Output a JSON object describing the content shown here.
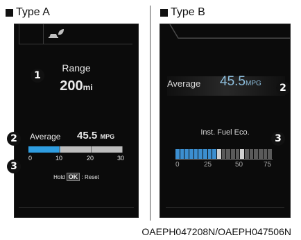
{
  "type_a": {
    "label": "Type A",
    "range": {
      "title": "Range",
      "value": "200",
      "unit": "mi"
    },
    "average": {
      "label": "Average",
      "value": "45.5",
      "unit": "MPG"
    },
    "gauge": {
      "ticks": [
        "0",
        "10",
        "20",
        "30"
      ],
      "fill_fraction": 0.34
    },
    "hint": {
      "prefix": "Hold",
      "key": "OK",
      "suffix": ": Reset"
    },
    "top_icon": "eco-car-leaf-icon"
  },
  "type_b": {
    "label": "Type B",
    "average": {
      "label": "Average",
      "value": "45.5",
      "unit": "MPG"
    },
    "inst": {
      "title": "Inst. Fuel Eco.",
      "ticks": [
        "0",
        "25",
        "50",
        "75"
      ],
      "segments_total": 21,
      "segments_filled": 9
    }
  },
  "badges": {
    "one": "1",
    "two": "2",
    "three": "3"
  },
  "caption": "OAEPH047208N/OAEPH047506N",
  "colors": {
    "gauge_fill": "#2f9de0",
    "gauge_track": "#bdbdbd",
    "seg_fill": "#3c8fd0"
  }
}
